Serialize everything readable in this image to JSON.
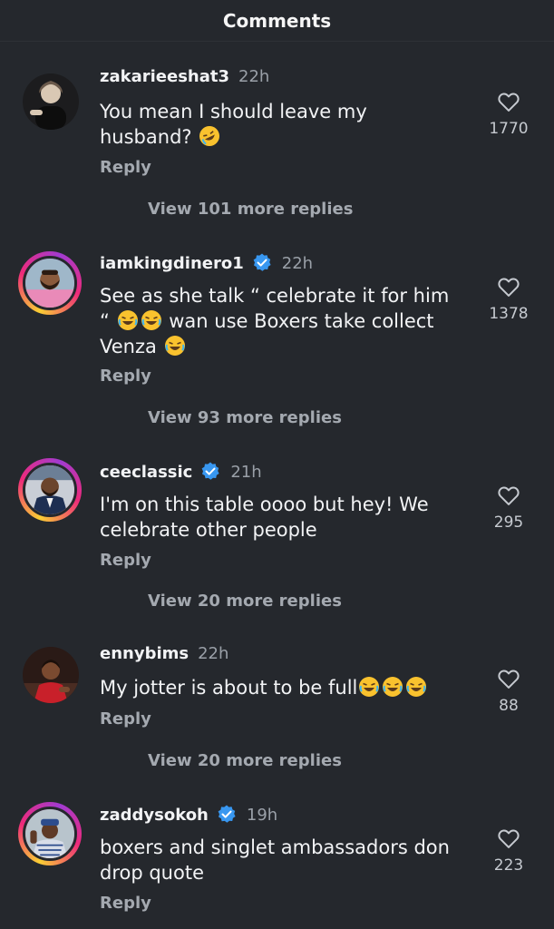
{
  "header": {
    "title": "Comments"
  },
  "comments": [
    {
      "username": "zakarieeshat3",
      "time": "22h",
      "verified": false,
      "text_before": "You mean I should leave my husband? ",
      "emojis_after": [
        "rofl"
      ],
      "likes": "1770",
      "reply_label": "Reply",
      "view_more": "View 101 more replies"
    },
    {
      "username": "iamkingdinero1",
      "time": "22h",
      "verified": true,
      "text_line1": "See as she talk “ celebrate it for him",
      "text_line2_prefix": "“ ",
      "text_line2_suffix": " wan use Boxers take collect",
      "text_line3": "Venza ",
      "likes": "1378",
      "reply_label": "Reply",
      "view_more": "View 93 more replies"
    },
    {
      "username": "ceeclassic",
      "time": "21h",
      "verified": true,
      "text": "I'm on this table oooo but hey! We celebrate other people",
      "likes": "295",
      "reply_label": "Reply",
      "view_more": "View 20 more replies"
    },
    {
      "username": "ennybims",
      "time": "22h",
      "verified": false,
      "text": "My jotter is about to be full",
      "likes": "88",
      "reply_label": "Reply",
      "view_more": "View 20 more replies"
    },
    {
      "username": "zaddysokoh",
      "time": "19h",
      "verified": true,
      "text": "boxers and singlet ambassadors don drop quote",
      "likes": "223",
      "reply_label": "Reply"
    }
  ],
  "colors": {
    "background": "#25282d",
    "verified_blue": "#3897f0",
    "muted_text": "#a4a9b0"
  },
  "icons": {
    "like": "heart-outline-icon",
    "verified": "verified-badge-icon",
    "emoji_laugh": "face-with-tears-of-joy",
    "emoji_rofl": "rolling-on-floor-laughing"
  }
}
